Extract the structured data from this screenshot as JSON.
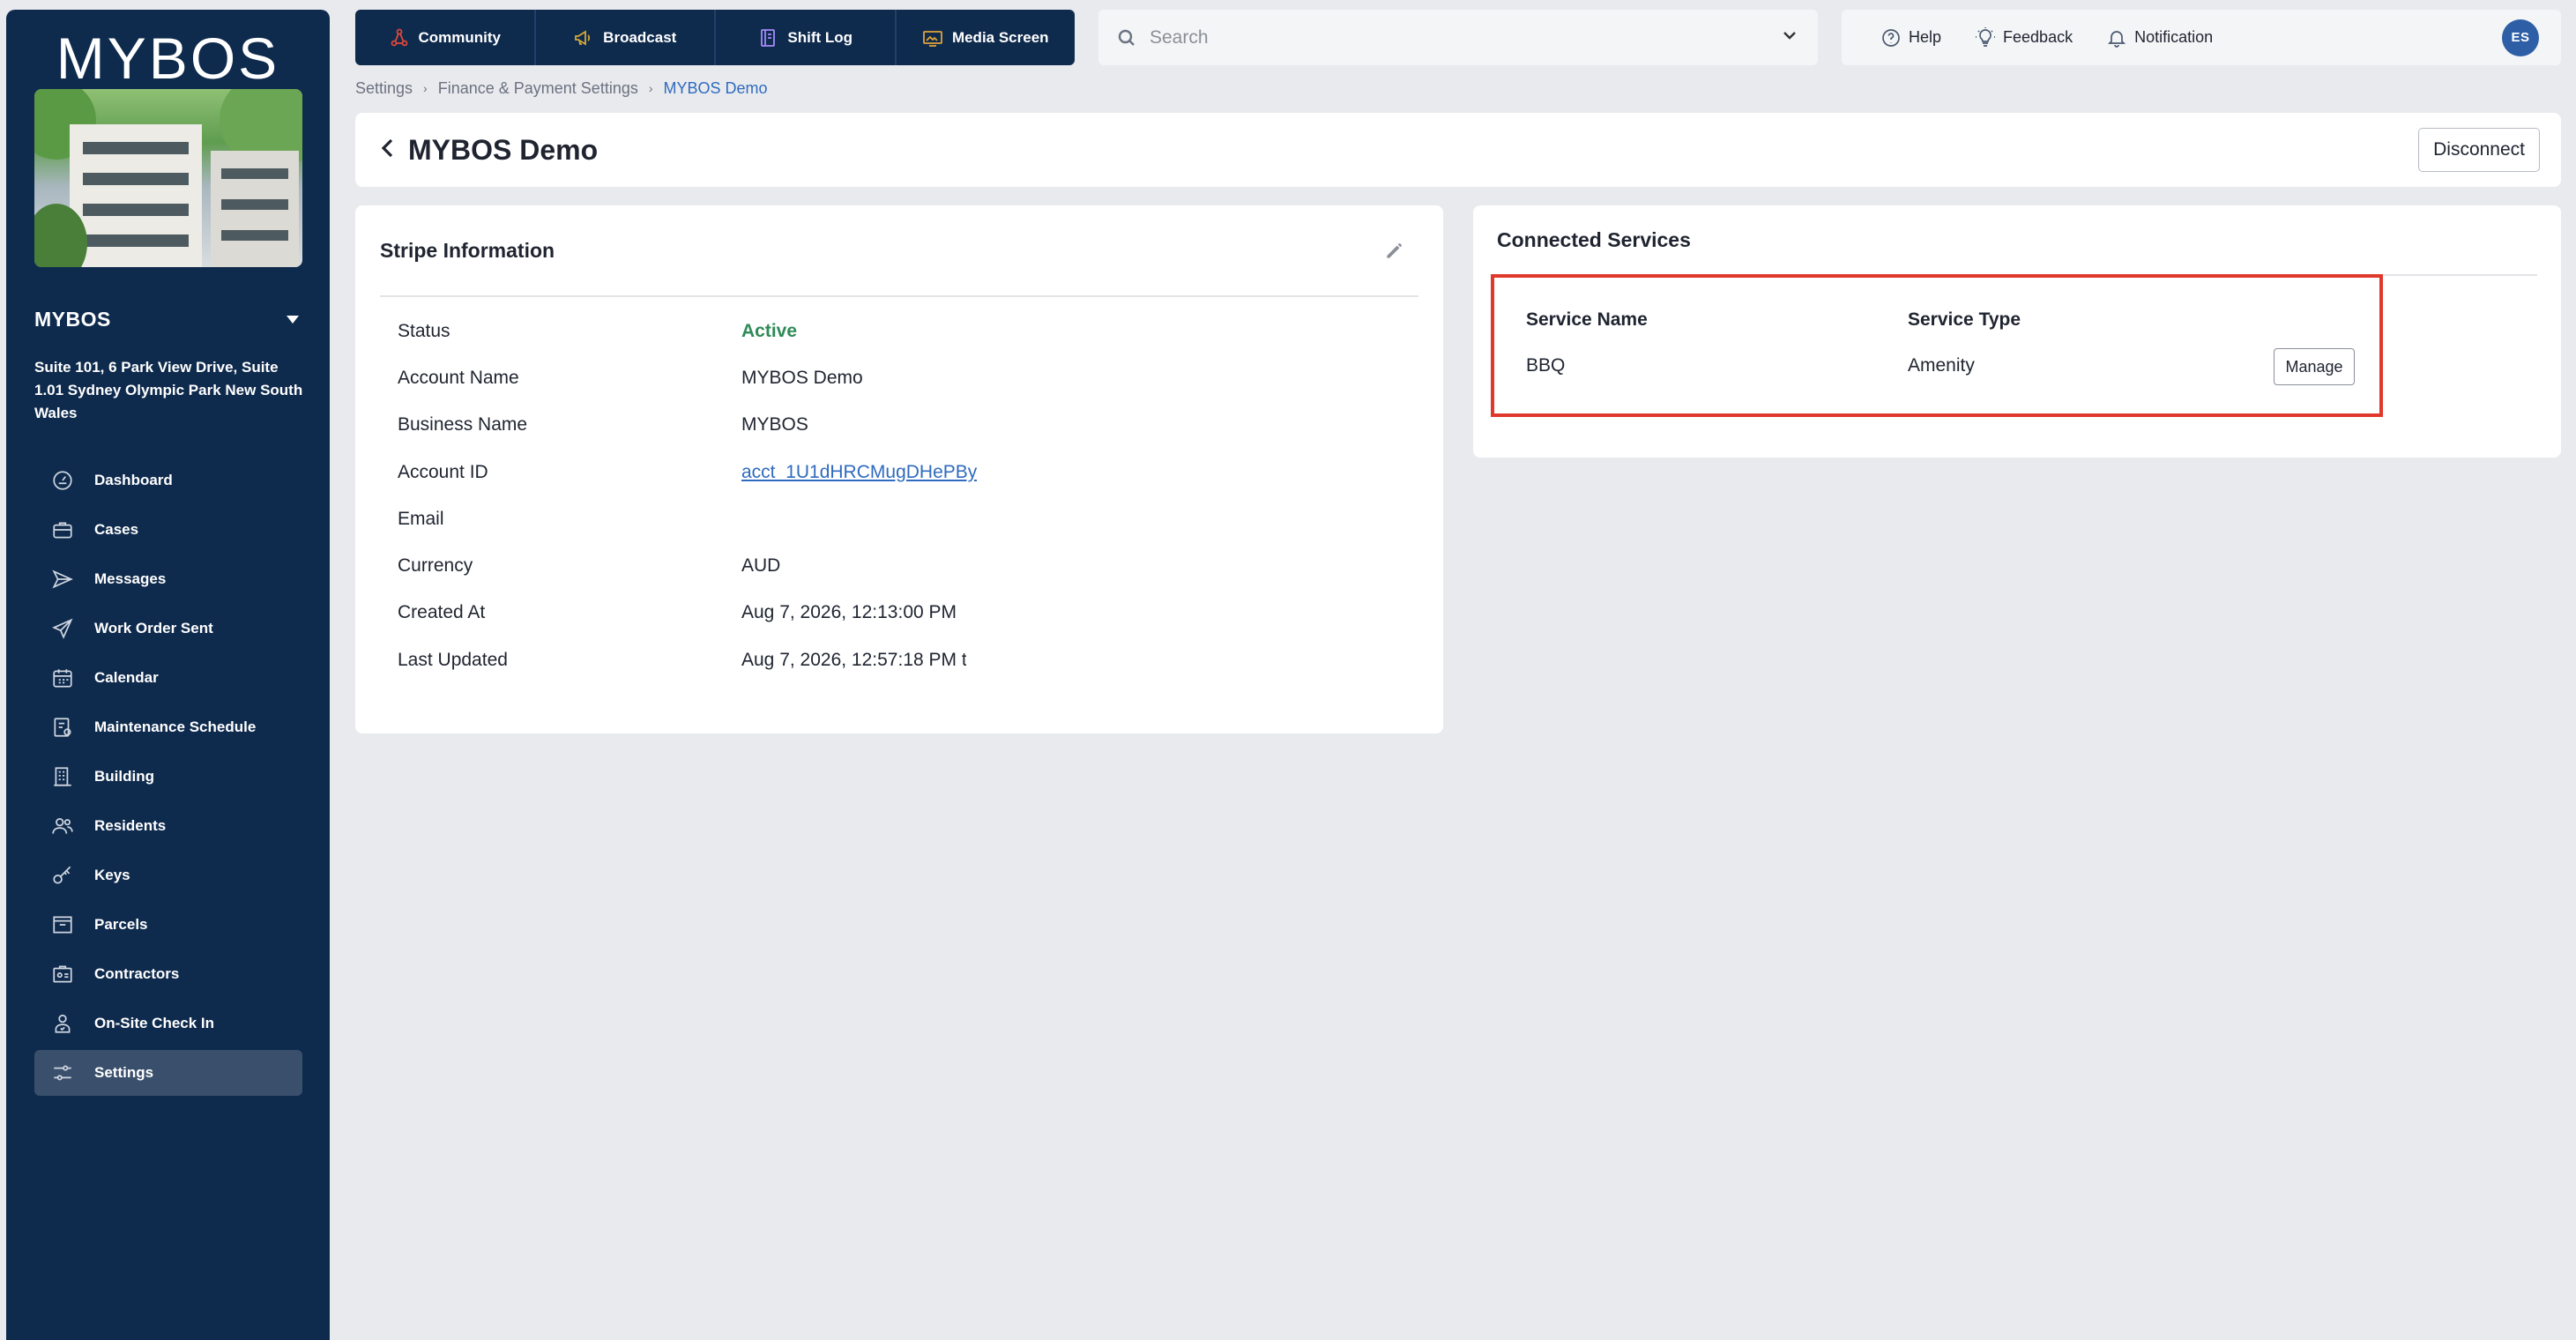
{
  "brand": {
    "logo_text": "MYBOS"
  },
  "site": {
    "name": "MYBOS",
    "address": "Suite 101, 6 Park View Drive, Suite 1.01 Sydney Olympic Park New South Wales"
  },
  "sidebar": {
    "items": [
      {
        "label": "Dashboard",
        "icon": "dashboard-icon",
        "active": false
      },
      {
        "label": "Cases",
        "icon": "briefcase-icon",
        "active": false
      },
      {
        "label": "Messages",
        "icon": "send-icon",
        "active": false
      },
      {
        "label": "Work Order Sent",
        "icon": "paper-plane-icon",
        "active": false
      },
      {
        "label": "Calendar",
        "icon": "calendar-icon",
        "active": false
      },
      {
        "label": "Maintenance Schedule",
        "icon": "maintenance-icon",
        "active": false
      },
      {
        "label": "Building",
        "icon": "building-icon",
        "active": false
      },
      {
        "label": "Residents",
        "icon": "residents-icon",
        "active": false
      },
      {
        "label": "Keys",
        "icon": "key-icon",
        "active": false
      },
      {
        "label": "Parcels",
        "icon": "parcel-icon",
        "active": false
      },
      {
        "label": "Contractors",
        "icon": "contractor-icon",
        "active": false
      },
      {
        "label": "On-Site Check In",
        "icon": "check-in-icon",
        "active": false
      },
      {
        "label": "Settings",
        "icon": "settings-icon",
        "active": true
      }
    ]
  },
  "topbar": {
    "quick_nav": [
      {
        "label": "Community",
        "icon": "community-icon"
      },
      {
        "label": "Broadcast",
        "icon": "megaphone-icon"
      },
      {
        "label": "Shift Log",
        "icon": "notebook-icon"
      },
      {
        "label": "Media Screen",
        "icon": "screen-icon"
      }
    ],
    "search": {
      "placeholder": "Search"
    },
    "utilities": {
      "help": "Help",
      "feedback": "Feedback",
      "notification": "Notification"
    },
    "avatar_initials": "ES"
  },
  "breadcrumb": [
    "Settings",
    "Finance & Payment Settings",
    "MYBOS Demo"
  ],
  "page": {
    "title": "MYBOS Demo",
    "disconnect_label": "Disconnect"
  },
  "stripe": {
    "title": "Stripe Information",
    "rows": [
      {
        "key": "Status",
        "value": "Active"
      },
      {
        "key": "Account Name",
        "value": "MYBOS Demo"
      },
      {
        "key": "Business Name",
        "value": "MYBOS"
      },
      {
        "key": "Account ID",
        "value": "acct_1U1dHRCMugDHePBy"
      },
      {
        "key": "Email",
        "value": ""
      },
      {
        "key": "Currency",
        "value": "AUD"
      },
      {
        "key": "Created At",
        "value": "Aug 7, 2026, 12:13:00 PM"
      },
      {
        "key": "Last Updated",
        "value": "Aug 7, 2026, 12:57:18 PM t"
      }
    ]
  },
  "services": {
    "title": "Connected Services",
    "headers": {
      "name": "Service Name",
      "type": "Service Type"
    },
    "rows": [
      {
        "name": "BBQ",
        "type": "Amenity",
        "action": "Manage"
      }
    ]
  },
  "colors": {
    "sidebar_bg": "#0e2a4d",
    "active_status": "#2e8b57",
    "link": "#2f6bbf",
    "highlight": "#e0392b"
  }
}
